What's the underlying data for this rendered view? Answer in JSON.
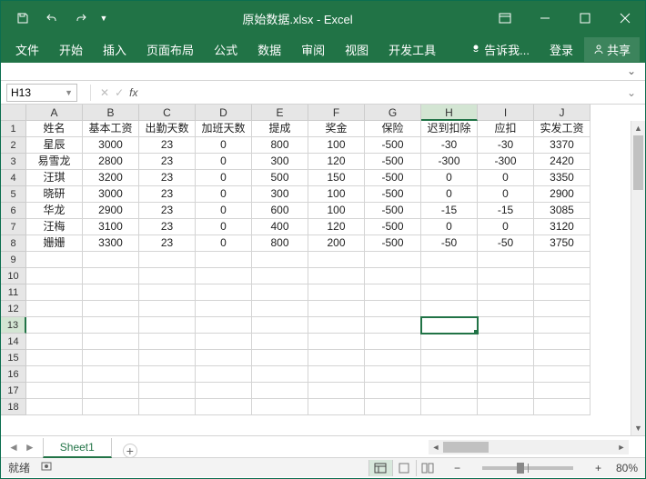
{
  "title": "原始数据.xlsx - Excel",
  "ribbon": {
    "tabs": [
      "文件",
      "开始",
      "插入",
      "页面布局",
      "公式",
      "数据",
      "审阅",
      "视图",
      "开发工具"
    ],
    "tell_me": "告诉我...",
    "login": "登录",
    "share": "共享"
  },
  "formula_bar": {
    "name_box": "H13",
    "fx_label": "fx",
    "value": ""
  },
  "columns": [
    "A",
    "B",
    "C",
    "D",
    "E",
    "F",
    "G",
    "H",
    "I",
    "J"
  ],
  "row_numbers": [
    1,
    2,
    3,
    4,
    5,
    6,
    7,
    8,
    9,
    10,
    11,
    12,
    13,
    14,
    15,
    16,
    17,
    18
  ],
  "active_col_index": 7,
  "active_row_index": 12,
  "active_cell": {
    "row": 12,
    "col": 7
  },
  "chart_data": {
    "type": "table",
    "headers": [
      "姓名",
      "基本工资",
      "出勤天数",
      "加班天数",
      "提成",
      "奖金",
      "保险",
      "迟到扣除",
      "应扣",
      "实发工资"
    ],
    "rows": [
      [
        "星辰",
        "3000",
        "23",
        "0",
        "800",
        "100",
        "-500",
        "-30",
        "-30",
        "3370"
      ],
      [
        "易雪龙",
        "2800",
        "23",
        "0",
        "300",
        "120",
        "-500",
        "-300",
        "-300",
        "2420"
      ],
      [
        "汪琪",
        "3200",
        "23",
        "0",
        "500",
        "150",
        "-500",
        "0",
        "0",
        "3350"
      ],
      [
        "晓研",
        "3000",
        "23",
        "0",
        "300",
        "100",
        "-500",
        "0",
        "0",
        "2900"
      ],
      [
        "华龙",
        "2900",
        "23",
        "0",
        "600",
        "100",
        "-500",
        "-15",
        "-15",
        "3085"
      ],
      [
        "汪梅",
        "3100",
        "23",
        "0",
        "400",
        "120",
        "-500",
        "0",
        "0",
        "3120"
      ],
      [
        "姗姗",
        "3300",
        "23",
        "0",
        "800",
        "200",
        "-500",
        "-50",
        "-50",
        "3750"
      ]
    ]
  },
  "sheet": {
    "name": "Sheet1"
  },
  "status": {
    "ready": "就绪",
    "zoom": "80%"
  }
}
